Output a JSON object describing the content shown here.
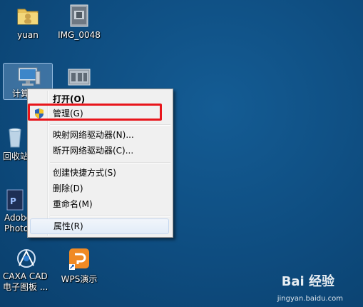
{
  "desktop": {
    "icons": {
      "yuan": "yuan",
      "img": "IMG_0048",
      "computer": "计算机",
      "recycle": "回收站",
      "photoshop_1": "Adobe",
      "photoshop_2": "Photoshop",
      "caxa_1": "CAXA CAD",
      "caxa_2": "电子图板 ...",
      "wps": "WPS演示"
    }
  },
  "context_menu": {
    "items": [
      {
        "label": "打开(O)"
      },
      {
        "label": "管理(G)"
      },
      {
        "label": "映射网络驱动器(N)..."
      },
      {
        "label": "断开网络驱动器(C)..."
      },
      {
        "label": "创建快捷方式(S)"
      },
      {
        "label": "删除(D)"
      },
      {
        "label": "重命名(M)"
      },
      {
        "label": "属性(R)"
      }
    ]
  },
  "watermark": {
    "logo": "Bai 经验",
    "url": "jingyan.baidu.com"
  },
  "colors": {
    "desktop": "#0f4e82",
    "highlight": "#e8151b"
  }
}
